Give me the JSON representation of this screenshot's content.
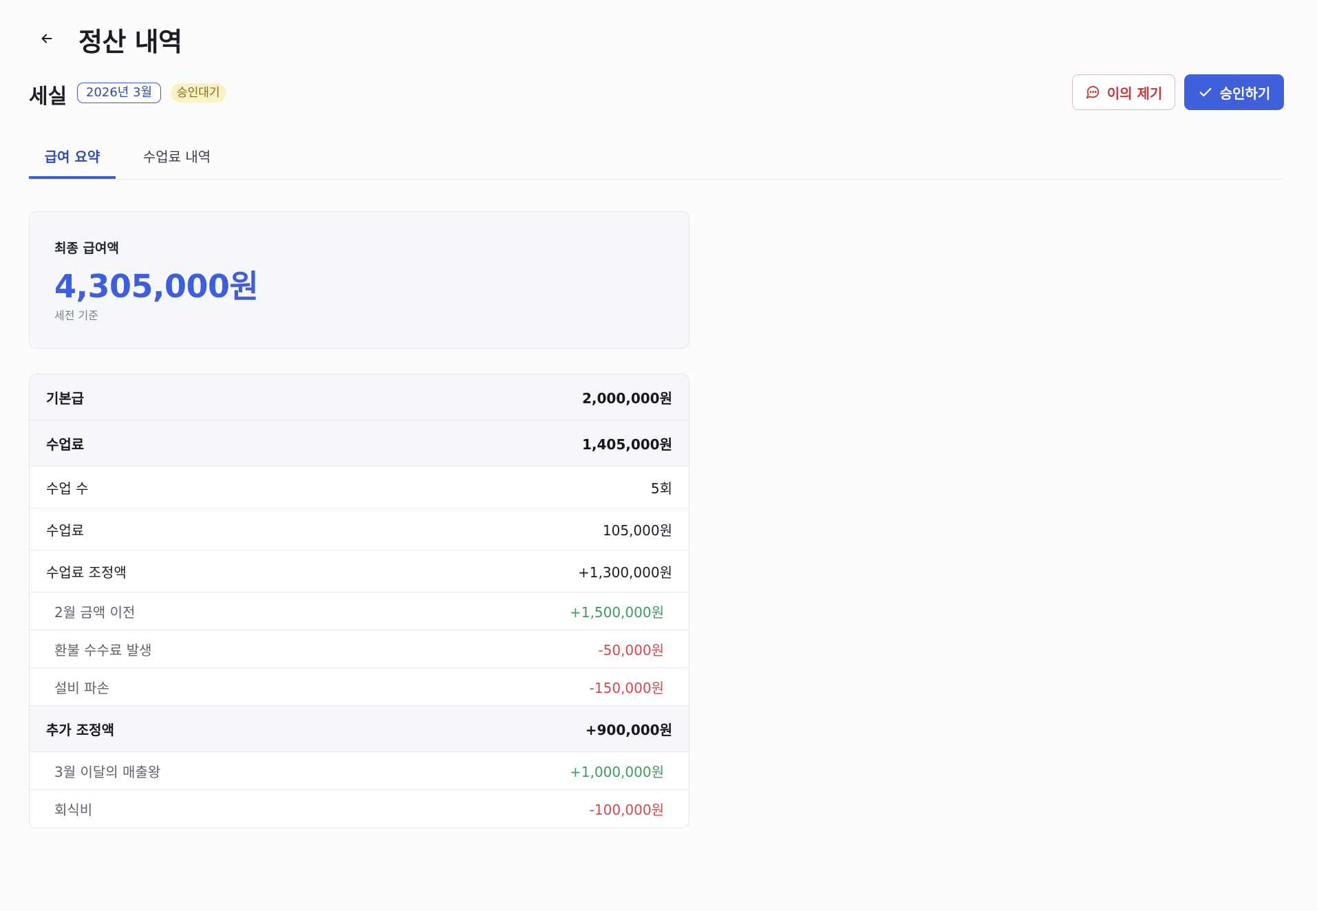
{
  "header": {
    "back_icon": "arrow-left-icon",
    "title": "정산 내역"
  },
  "employee": {
    "name": "세실",
    "period": "2026년 3월",
    "status": "승인대기",
    "status_color": "#fbf1c8"
  },
  "actions": {
    "objection_label": "이의 제기",
    "objection_icon": "message-circle-icon",
    "approve_label": "승인하기",
    "approve_icon": "check-icon",
    "accent_color": "#3f5fdb"
  },
  "tabs": [
    {
      "label": "급여 요약",
      "active": true
    },
    {
      "label": "수업료 내역",
      "active": false
    }
  ],
  "summary": {
    "label": "최종 급여액",
    "amount": "4,305,000원",
    "note": "세전 기준"
  },
  "breakdown": {
    "base_pay": {
      "label": "기본급",
      "value": "2,000,000원"
    },
    "tuition": {
      "label": "수업료",
      "value": "1,405,000원"
    },
    "class_count": {
      "label": "수업 수",
      "value": "5회"
    },
    "tuition_fee": {
      "label": "수업료",
      "value": "105,000원"
    },
    "tuition_adjust": {
      "label": "수업료 조정액",
      "value": "+1,300,000원"
    },
    "tuition_adjust_items": [
      {
        "label": "2월 금액 이전",
        "value": "+1,500,000원"
      },
      {
        "label": "환불 수수료 발생",
        "value": "-50,000원"
      },
      {
        "label": "설비 파손",
        "value": "-150,000원"
      }
    ],
    "extra_adjust": {
      "label": "추가 조정액",
      "value": "+900,000원"
    },
    "extra_adjust_items": [
      {
        "label": "3월 이달의 매출왕",
        "value": "+1,000,000원"
      },
      {
        "label": "회식비",
        "value": "-100,000원"
      }
    ]
  }
}
